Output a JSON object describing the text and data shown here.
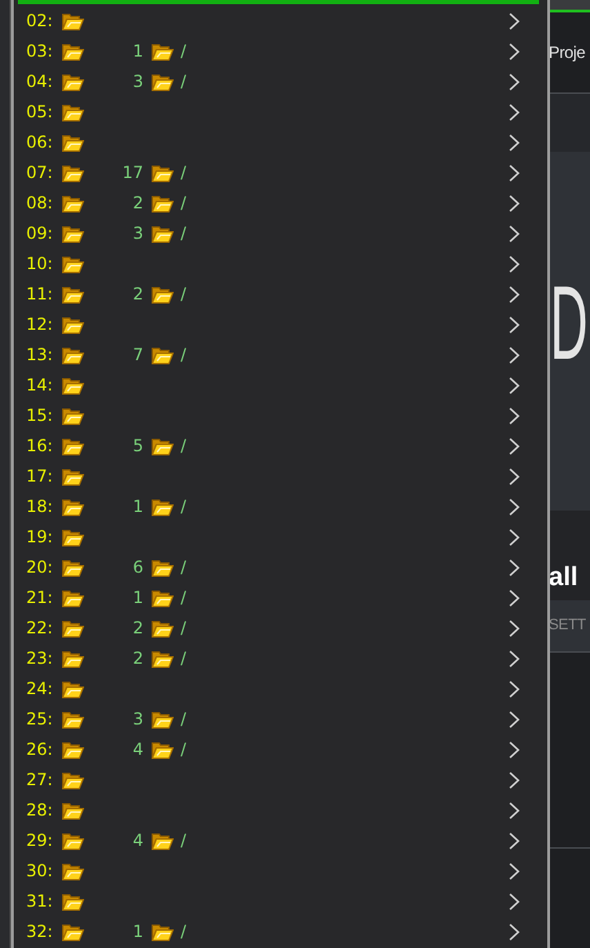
{
  "background": {
    "tab_label": "Proje",
    "heading": "D",
    "title": "all",
    "settings_label": "SETT"
  },
  "menu": {
    "items": [
      {
        "label": "02:"
      },
      {
        "label": "03:",
        "count": "1",
        "path": "/"
      },
      {
        "label": "04:",
        "count": "3",
        "path": "/"
      },
      {
        "label": "05:"
      },
      {
        "label": "06:"
      },
      {
        "label": "07:",
        "count": "17",
        "path": "/"
      },
      {
        "label": "08:",
        "count": "2",
        "path": "/"
      },
      {
        "label": "09:",
        "count": "3",
        "path": "/"
      },
      {
        "label": "10:"
      },
      {
        "label": "11:",
        "count": "2",
        "path": "/"
      },
      {
        "label": "12:"
      },
      {
        "label": "13:",
        "count": "7",
        "path": "/"
      },
      {
        "label": "14:"
      },
      {
        "label": "15:"
      },
      {
        "label": "16:",
        "count": "5",
        "path": "/"
      },
      {
        "label": "17:"
      },
      {
        "label": "18:",
        "count": "1",
        "path": "/"
      },
      {
        "label": "19:"
      },
      {
        "label": "20:",
        "count": "6",
        "path": "/"
      },
      {
        "label": "21:",
        "count": "1",
        "path": "/"
      },
      {
        "label": "22:",
        "count": "2",
        "path": "/"
      },
      {
        "label": "23:",
        "count": "2",
        "path": "/"
      },
      {
        "label": "24:"
      },
      {
        "label": "25:",
        "count": "3",
        "path": "/"
      },
      {
        "label": "26:",
        "count": "4",
        "path": "/"
      },
      {
        "label": "27:"
      },
      {
        "label": "28:"
      },
      {
        "label": "29:",
        "count": "4",
        "path": "/"
      },
      {
        "label": "30:"
      },
      {
        "label": "31:"
      },
      {
        "label": "32:",
        "count": "1",
        "path": "/"
      }
    ]
  }
}
